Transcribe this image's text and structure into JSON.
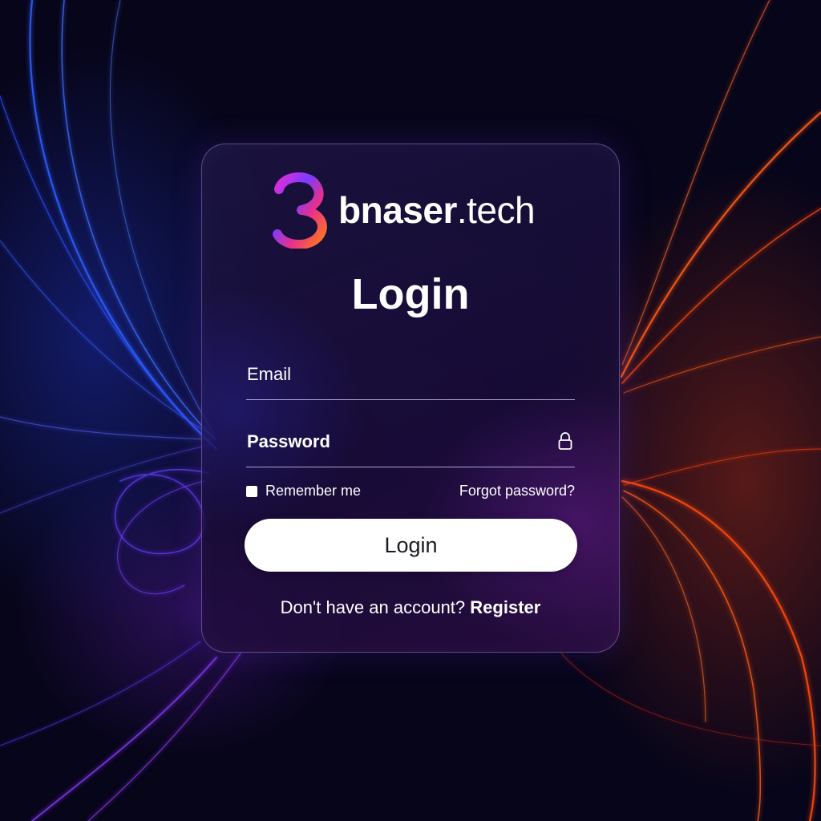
{
  "brand": {
    "name_bold": "bnaser",
    "name_light": ".tech",
    "logo_icon": "b3-gradient-logo-icon"
  },
  "form": {
    "title": "Login",
    "email_label": "Email",
    "email_value": "",
    "password_label": "Password",
    "password_value": "",
    "password_icon": "lock-icon",
    "remember_label": "Remember me",
    "remember_checked": false,
    "forgot_label": "Forgot password?",
    "submit_label": "Login",
    "register_prompt": "Don't have an account?",
    "register_link": "Register"
  },
  "colors": {
    "accent_blue": "#2b5bff",
    "accent_orange": "#ff5a1a",
    "accent_magenta": "#e82bd8",
    "background": "#07051a",
    "button": "#ffffff"
  }
}
